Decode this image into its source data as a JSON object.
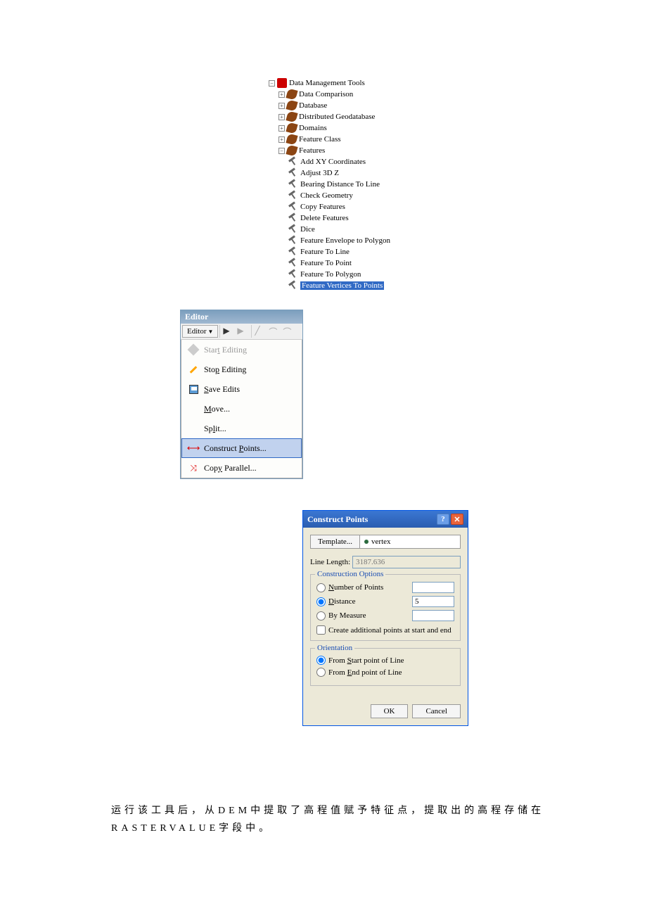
{
  "tree": {
    "root": "Data Management Tools",
    "children": [
      "Data Comparison",
      "Database",
      "Distributed Geodatabase",
      "Domains",
      "Feature Class",
      "Features"
    ],
    "tools": [
      "Add XY Coordinates",
      "Adjust 3D Z",
      "Bearing Distance To Line",
      "Check Geometry",
      "Copy Features",
      "Delete Features",
      "Dice",
      "Feature Envelope to Polygon",
      "Feature To Line",
      "Feature To Point",
      "Feature To Polygon",
      "Feature Vertices To Points"
    ]
  },
  "editor": {
    "title": "Editor",
    "button": "Editor",
    "menu": {
      "start": "Start Editing",
      "stop": "Stop Editing",
      "save": "Save Edits",
      "move": "Move...",
      "split": "Split...",
      "construct": "Construct Points...",
      "parallel": "Copy Parallel..."
    }
  },
  "dialog": {
    "title": "Construct Points",
    "template_btn": "Template...",
    "template_val": "vertex",
    "linelen_label": "Line Length:",
    "linelen_val": "3187.636",
    "options_legend": "Construction Options",
    "opt_num": "Number of Points",
    "opt_dist": "Distance",
    "opt_dist_val": "5",
    "opt_measure": "By Measure",
    "check_additional": "Create additional points at start and end",
    "orient_legend": "Orientation",
    "orient_start": "From Start point of Line",
    "orient_end": "From End point of Line",
    "ok": "OK",
    "cancel": "Cancel"
  },
  "text": {
    "p1": "运行该工具后，从DEM中提取了高程值赋予特征点，提取出的高程存储在 RASTERVALUE字段中。"
  }
}
